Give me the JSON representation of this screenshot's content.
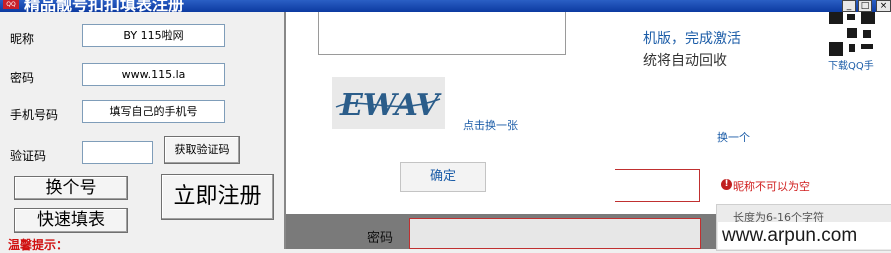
{
  "window": {
    "title": "精品靓号扣扣填表注册",
    "icon": "app-icon",
    "controls": [
      "minimize",
      "maximize",
      "close"
    ]
  },
  "form": {
    "nickname_label": "昵称",
    "nickname_value": "BY 115啦网",
    "password_label": "密码",
    "password_value": "www.115.la",
    "phone_label": "手机号码",
    "phone_value": "填写自己的手机号",
    "code_label": "验证码",
    "code_value": "",
    "get_code_button": "获取验证码",
    "change_number_button": "换个号",
    "register_button": "立即注册",
    "quick_fill_button": "快速填表",
    "tip_label": "温馨提示："
  },
  "captcha_popup": {
    "captcha_text": "EWAV",
    "refresh_link": "点击换一张",
    "confirm_button": "确定"
  },
  "background_page": {
    "activation_text": "机版，完成激活",
    "recycle_text": "统将自动回收",
    "download_link": "下载QQ手",
    "change_link": "换一个",
    "nickname_error": "昵称不可以为空",
    "length_hint": "长度为6-16个字符",
    "password_label": "密码",
    "watermark": "www.arpun.com"
  },
  "colors": {
    "titlebar": "#0c3aa0",
    "link": "#1c5da8",
    "error": "#d02020"
  }
}
